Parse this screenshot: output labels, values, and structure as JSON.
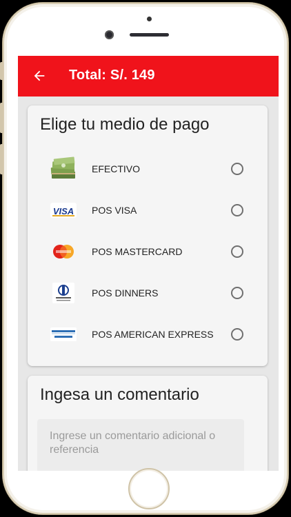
{
  "app_bar": {
    "title": "Total: S/. 149",
    "back_icon": "arrow-left-icon",
    "color": "#f0131b"
  },
  "payment_card": {
    "heading": "Elige tu medio de pago",
    "options": [
      {
        "label": "EFECTIVO",
        "icon": "cash-icon",
        "selected": false
      },
      {
        "label": "POS VISA",
        "icon": "visa-icon",
        "selected": false
      },
      {
        "label": "POS MASTERCARD",
        "icon": "mastercard-icon",
        "selected": false
      },
      {
        "label": "POS DINNERS",
        "icon": "diners-club-icon",
        "selected": false
      },
      {
        "label": "POS AMERICAN EXPRESS",
        "icon": "american-express-icon",
        "selected": false
      }
    ]
  },
  "comment_card": {
    "heading": "Ingesa un comentario",
    "placeholder": "Ingrese un comentario adicional o referencia"
  }
}
